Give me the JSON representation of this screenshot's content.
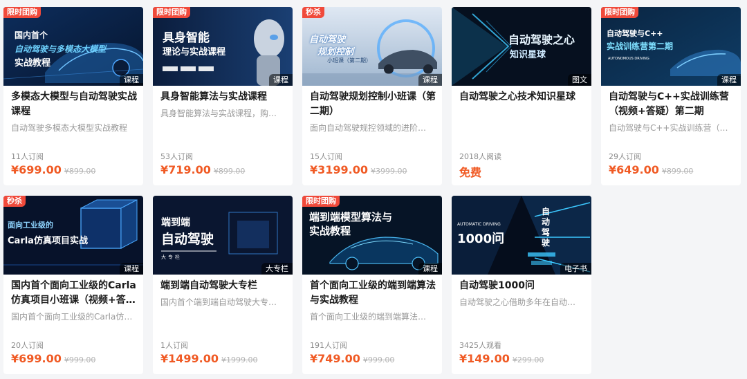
{
  "colors": {
    "page_background": "#f4f5f7",
    "badge_red": "#f04a3b",
    "price_orange": "#f05a24"
  },
  "cards": [
    {
      "badge": "限时团购",
      "type": "课程",
      "cover_lines": [
        "国内首个",
        "自动驾驶与多模态大模型",
        "实战教程"
      ],
      "title": "多模态大模型与自动驾驶实战课程",
      "subtitle": "自动驾驶多模态大模型实战教程",
      "meta": "11人订阅",
      "price": "¥699.00",
      "original_price": "¥899.00"
    },
    {
      "badge": "限时团购",
      "type": "课程",
      "cover_lines": [
        "具身智能",
        "理论与实战课程"
      ],
      "title": "具身智能算法与实战课程",
      "subtitle": "具身智能算法与实战课程，购…",
      "meta": "53人订阅",
      "price": "¥719.00",
      "original_price": "¥899.00"
    },
    {
      "badge": "秒杀",
      "type": "课程",
      "cover_lines": [
        "自动驾驶",
        "规划控制",
        "小班课（第二期）"
      ],
      "title": "自动驾驶规划控制小班课（第二期）",
      "subtitle": "面向自动驾驶规控领域的进阶…",
      "meta": "15人订阅",
      "price": "¥3199.00",
      "original_price": "¥3999.00"
    },
    {
      "badge": "",
      "type": "图文",
      "cover_lines": [
        "自动驾驶之心",
        "知识星球"
      ],
      "title": "自动驾驶之心技术知识星球",
      "subtitle": "",
      "meta": "2018人阅读",
      "price": "免费",
      "original_price": ""
    },
    {
      "badge": "限时团购",
      "type": "课程",
      "cover_lines": [
        "自动驾驶与C++",
        "实战训练营第二期",
        "AUTONOMOUS DRIVING"
      ],
      "title": "自动驾驶与C++实战训练营（视频+答疑）第二期",
      "subtitle": "自动驾驶与C++实战训练营（…",
      "meta": "29人订阅",
      "price": "¥649.00",
      "original_price": "¥899.00"
    },
    {
      "badge": "秒杀",
      "type": "课程",
      "cover_lines": [
        "面向工业级的",
        "Carla仿真项目实战"
      ],
      "title": "国内首个面向工业级的Carla仿真项目小班课（视频+答…",
      "subtitle": "国内首个面向工业级的Carla仿…",
      "meta": "20人订阅",
      "price": "¥699.00",
      "original_price": "¥999.00"
    },
    {
      "badge": "",
      "type": "大专栏",
      "cover_lines": [
        "端到端",
        "自动驾驶",
        "大专栏"
      ],
      "title": "端到端自动驾驶大专栏",
      "subtitle": "国内首个端到端自动驾驶大专…",
      "meta": "1人订阅",
      "price": "¥1499.00",
      "original_price": "¥1999.00"
    },
    {
      "badge": "限时团购",
      "type": "课程",
      "cover_lines": [
        "端到端模型算法与",
        "实战教程"
      ],
      "title": "首个面向工业级的端到端算法与实战教程",
      "subtitle": "首个面向工业级的端到端算法…",
      "meta": "191人订阅",
      "price": "¥749.00",
      "original_price": "¥999.00"
    },
    {
      "badge": "",
      "type": "电子书",
      "cover_lines": [
        "AUTOMATIC DRIVING",
        "1000问",
        "自动驾驶"
      ],
      "title": "自动驾驶1000问",
      "subtitle": "自动驾驶之心借助多年在自动…",
      "meta": "3425人观看",
      "price": "¥149.00",
      "original_price": "¥299.00"
    }
  ]
}
